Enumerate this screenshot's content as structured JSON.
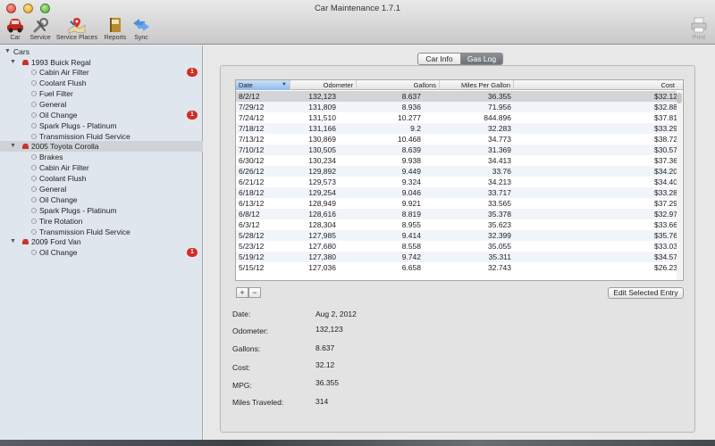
{
  "window": {
    "title": "Car Maintenance 1.7.1"
  },
  "toolbar": {
    "car": "Car",
    "service": "Service",
    "service_places": "Service Places",
    "reports": "Reports",
    "sync": "Sync",
    "print": "Print"
  },
  "sidebar": {
    "root": "Cars",
    "cars": [
      {
        "name": "1993 Buick Regal",
        "items": [
          {
            "label": "Cabin Air Filter",
            "badge": "1"
          },
          {
            "label": "Coolant Flush",
            "badge": ""
          },
          {
            "label": "Fuel Filter",
            "badge": ""
          },
          {
            "label": "General",
            "badge": ""
          },
          {
            "label": "Oil Change",
            "badge": "1"
          },
          {
            "label": "Spark Plugs - Platinum",
            "badge": ""
          },
          {
            "label": "Transmission Fluid Service",
            "badge": ""
          }
        ]
      },
      {
        "name": "2005 Toyota Corolla",
        "items": [
          {
            "label": "Brakes",
            "badge": ""
          },
          {
            "label": "Cabin Air Filter",
            "badge": ""
          },
          {
            "label": "Coolant Flush",
            "badge": ""
          },
          {
            "label": "General",
            "badge": ""
          },
          {
            "label": "Oil Change",
            "badge": ""
          },
          {
            "label": "Spark Plugs - Platinum",
            "badge": ""
          },
          {
            "label": "Tire Rotation",
            "badge": ""
          },
          {
            "label": "Transmission Fluid Service",
            "badge": ""
          }
        ]
      },
      {
        "name": "2009 Ford Van",
        "items": [
          {
            "label": "Oil Change",
            "badge": "1"
          }
        ]
      }
    ]
  },
  "tabs": {
    "car_info": "Car Info",
    "gas_log": "Gas Log"
  },
  "table": {
    "headers": {
      "date": "Date",
      "odometer": "Odometer",
      "gallons": "Gallons",
      "mpg": "Miles Per Gallon",
      "cost": "Cost"
    },
    "rows": [
      [
        "8/2/12",
        "132,123",
        "8.637",
        "36.355",
        "$32.12"
      ],
      [
        "7/29/12",
        "131,809",
        "8.936",
        "71.956",
        "$32.88"
      ],
      [
        "7/24/12",
        "131,510",
        "10.277",
        "844.896",
        "$37.81"
      ],
      [
        "7/18/12",
        "131,166",
        "9.2",
        "32.283",
        "$33.29"
      ],
      [
        "7/13/12",
        "130,869",
        "10.468",
        "34.773",
        "$38.72"
      ],
      [
        "7/10/12",
        "130,505",
        "8.639",
        "31.369",
        "$30.57"
      ],
      [
        "6/30/12",
        "130,234",
        "9.938",
        "34.413",
        "$37.36"
      ],
      [
        "6/26/12",
        "129,892",
        "9.449",
        "33.76",
        "$34.20"
      ],
      [
        "6/21/12",
        "129,573",
        "9.324",
        "34.213",
        "$34.40"
      ],
      [
        "6/18/12",
        "129,254",
        "9.046",
        "33.717",
        "$33.28"
      ],
      [
        "6/13/12",
        "128,949",
        "9.921",
        "33.565",
        "$37.29"
      ],
      [
        "6/8/12",
        "128,616",
        "8.819",
        "35.378",
        "$32.97"
      ],
      [
        "6/3/12",
        "128,304",
        "8.955",
        "35.623",
        "$33.66"
      ],
      [
        "5/28/12",
        "127,985",
        "9.414",
        "32.399",
        "$35.76"
      ],
      [
        "5/23/12",
        "127,680",
        "8.558",
        "35.055",
        "$33.03"
      ],
      [
        "5/19/12",
        "127,380",
        "9.742",
        "35.311",
        "$34.57"
      ],
      [
        "5/15/12",
        "127,036",
        "6.658",
        "32.743",
        "$26.23"
      ]
    ]
  },
  "buttons": {
    "add": "+",
    "remove": "−",
    "edit": "Edit Selected Entry"
  },
  "details": [
    {
      "label": "Date:",
      "value": "Aug 2, 2012"
    },
    {
      "label": "Odometer:",
      "value": "132,123"
    },
    {
      "label": "Gallons:",
      "value": "8.637"
    },
    {
      "label": "Cost:",
      "value": "32.12"
    },
    {
      "label": "MPG:",
      "value": "36.355"
    },
    {
      "label": "Miles Traveled:",
      "value": "314"
    }
  ],
  "colors": {
    "badge": "#d42b1e",
    "sidebar_bg": "#dfe6ee",
    "selection": "#d2d4d8",
    "header_sorted": "#8eb9ec"
  },
  "icons": [
    "car-icon",
    "wrench-icon",
    "map-pin-icon",
    "book-icon",
    "sync-arrows-icon",
    "printer-icon",
    "gear-icon",
    "triangle-disclosure-icon"
  ]
}
